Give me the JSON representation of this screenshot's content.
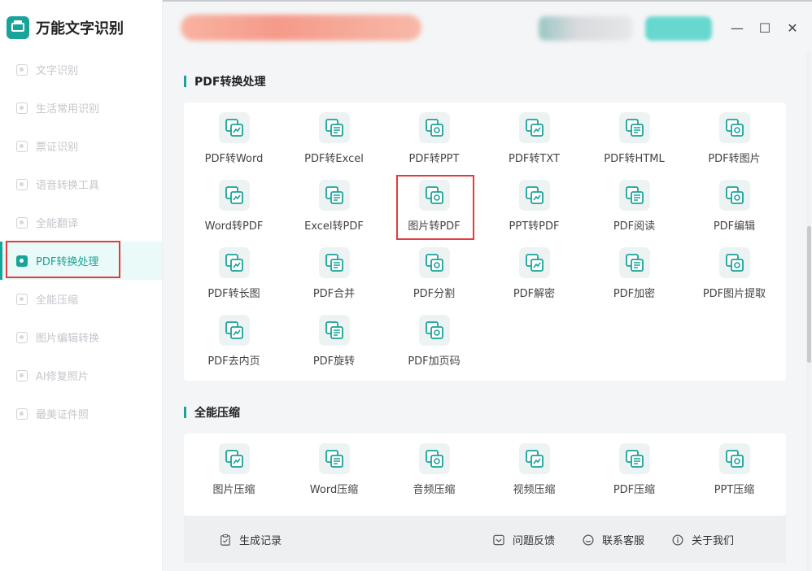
{
  "app": {
    "title": "万能文字识别"
  },
  "sidebar": {
    "items": [
      {
        "label": "文字识别"
      },
      {
        "label": "生活常用识别"
      },
      {
        "label": "票证识别"
      },
      {
        "label": "语音转换工具"
      },
      {
        "label": "全能翻译"
      },
      {
        "label": "PDF转换处理"
      },
      {
        "label": "全能压缩"
      },
      {
        "label": "图片编辑转换"
      },
      {
        "label": "AI修复照片"
      },
      {
        "label": "最美证件照"
      }
    ],
    "active": "PDF转换处理"
  },
  "window": {
    "minimize": "—",
    "maximize": "☐",
    "close": "✕"
  },
  "pdf_section": {
    "title": "PDF转换处理",
    "tools": [
      {
        "label": "PDF转Word",
        "icon": "pdf-to-word-icon"
      },
      {
        "label": "PDF转Excel",
        "icon": "pdf-to-excel-icon"
      },
      {
        "label": "PDF转PPT",
        "icon": "pdf-to-ppt-icon"
      },
      {
        "label": "PDF转TXT",
        "icon": "pdf-to-txt-icon"
      },
      {
        "label": "PDF转HTML",
        "icon": "pdf-to-html-icon"
      },
      {
        "label": "PDF转图片",
        "icon": "pdf-to-image-icon"
      },
      {
        "label": "Word转PDF",
        "icon": "word-to-pdf-icon"
      },
      {
        "label": "Excel转PDF",
        "icon": "excel-to-pdf-icon"
      },
      {
        "label": "图片转PDF",
        "icon": "image-to-pdf-icon"
      },
      {
        "label": "PPT转PDF",
        "icon": "ppt-to-pdf-icon"
      },
      {
        "label": "PDF阅读",
        "icon": "pdf-read-icon"
      },
      {
        "label": "PDF编辑",
        "icon": "pdf-edit-icon"
      },
      {
        "label": "PDF转长图",
        "icon": "pdf-to-long-image-icon"
      },
      {
        "label": "PDF合并",
        "icon": "pdf-merge-icon"
      },
      {
        "label": "PDF分割",
        "icon": "pdf-split-icon"
      },
      {
        "label": "PDF解密",
        "icon": "pdf-decrypt-icon"
      },
      {
        "label": "PDF加密",
        "icon": "pdf-encrypt-icon"
      },
      {
        "label": "PDF图片提取",
        "icon": "pdf-image-extract-icon"
      },
      {
        "label": "PDF去内页",
        "icon": "pdf-remove-pages-icon"
      },
      {
        "label": "PDF旋转",
        "icon": "pdf-rotate-icon"
      },
      {
        "label": "PDF加页码",
        "icon": "pdf-page-number-icon"
      }
    ]
  },
  "compress_section": {
    "title": "全能压缩",
    "tools": [
      {
        "label": "图片压缩",
        "icon": "image-compress-icon"
      },
      {
        "label": "Word压缩",
        "icon": "word-compress-icon"
      },
      {
        "label": "音频压缩",
        "icon": "audio-compress-icon"
      },
      {
        "label": "视频压缩",
        "icon": "video-compress-icon"
      },
      {
        "label": "PDF压缩",
        "icon": "pdf-compress-icon"
      },
      {
        "label": "PPT压缩",
        "icon": "ppt-compress-icon"
      }
    ]
  },
  "footer": {
    "history": "生成记录",
    "feedback": "问题反馈",
    "support": "联系客服",
    "about": "关于我们"
  },
  "colors": {
    "accent": "#1aa39a",
    "highlight": "#e23b3b"
  }
}
